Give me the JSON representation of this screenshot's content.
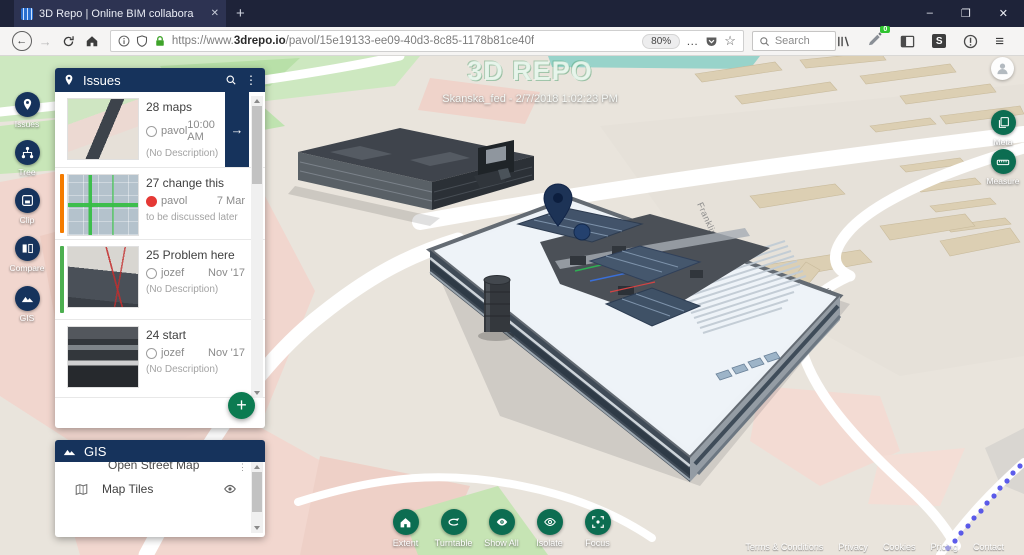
{
  "browser": {
    "tab_title": "3D Repo | Online BIM collabora",
    "window_controls": [
      "–",
      "❐",
      "✕"
    ],
    "url": {
      "prefix": "https://www.",
      "domain": "3drepo.io",
      "path": "/pavol/15e19133-ee09-40d3-8c85-1178b81ce40f"
    },
    "zoom_badge": "80%",
    "search_placeholder": "Search",
    "ext_badge": "0",
    "s_app_letter": "S"
  },
  "icons": {
    "back": "←",
    "forward": "→",
    "ellipsis": "…",
    "star": "☆",
    "hamburger": "≡",
    "kebab": "⋮",
    "plus": "+",
    "arrow_right": "→",
    "tab_close": "✕",
    "new_tab": "+"
  },
  "viewer": {
    "logo_text": "3D REPO",
    "caption": "Skanska_fed - 2/7/2018 1:02:23 PM",
    "road_label_1": "Franklins",
    "road_label_2": "Franklins"
  },
  "left_nav": {
    "items": [
      {
        "label": "Issues"
      },
      {
        "label": "Tree"
      },
      {
        "label": "Clip"
      },
      {
        "label": "Compare"
      },
      {
        "label": "GIS"
      }
    ]
  },
  "issues_panel": {
    "title": "Issues",
    "items": [
      {
        "title": "28 maps",
        "author": "pavol",
        "time": "10:00 AM",
        "desc": "(No Description)"
      },
      {
        "title": "27 change this",
        "author": "pavol",
        "time": "7 Mar",
        "desc": "to be discussed later"
      },
      {
        "title": "25 Problem here",
        "author": "jozef",
        "time": "Nov '17",
        "desc": "(No Description)"
      },
      {
        "title": "24 start",
        "author": "jozef",
        "time": "Nov '17",
        "desc": "(No Description)"
      }
    ]
  },
  "gis_panel": {
    "title": "GIS",
    "section_label": "Open Street Map",
    "rows": [
      {
        "label": "Map Tiles"
      }
    ]
  },
  "right_nav": {
    "items": [
      {
        "label": "Meta"
      },
      {
        "label": "Measure"
      }
    ]
  },
  "bottom_nav": {
    "items": [
      {
        "label": "Extent"
      },
      {
        "label": "Turntable"
      },
      {
        "label": "Show All"
      },
      {
        "label": "Isolate"
      },
      {
        "label": "Focus"
      }
    ]
  },
  "footer": {
    "links": [
      "Terms & Conditions",
      "Privacy",
      "Cookies",
      "Pricing",
      "Contact"
    ]
  },
  "colors": {
    "navy": "#16335c",
    "green": "#0c6d51",
    "titlebar": "#1e2339",
    "map_base": "#e9e4dc",
    "bar_orange": "#f57c00",
    "bar_green": "#4caf50",
    "avatar_red": "#e53935",
    "route_blue": "#4040e8"
  }
}
